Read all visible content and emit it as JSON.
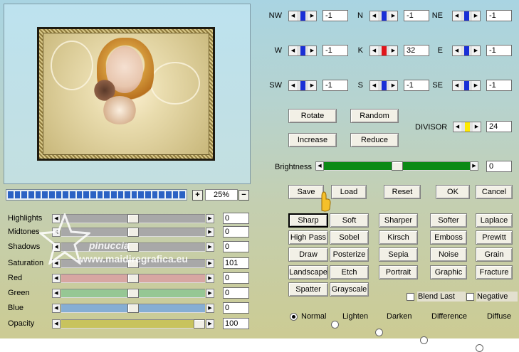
{
  "directions": [
    {
      "label": "NW",
      "value": "-1",
      "color": "#1a2fd6"
    },
    {
      "label": "N",
      "value": "-1",
      "color": "#1a2fd6"
    },
    {
      "label": "NE",
      "value": "-1",
      "color": "#1a2fd6"
    },
    {
      "label": "W",
      "value": "-1",
      "color": "#1a2fd6"
    },
    {
      "label": "K",
      "value": "32",
      "color": "#e0151b"
    },
    {
      "label": "E",
      "value": "-1",
      "color": "#1a2fd6"
    },
    {
      "label": "SW",
      "value": "-1",
      "color": "#1a2fd6"
    },
    {
      "label": "S",
      "value": "-1",
      "color": "#1a2fd6"
    },
    {
      "label": "SE",
      "value": "-1",
      "color": "#1a2fd6"
    }
  ],
  "actions": {
    "rotate": "Rotate",
    "random": "Random",
    "increase": "Increase",
    "reduce": "Reduce"
  },
  "divisor": {
    "label": "DIVISOR",
    "value": "24",
    "color": "#ffea00"
  },
  "brightness": {
    "label": "Brightness",
    "value": "0",
    "level": 0.5
  },
  "file_buttons": {
    "save": "Save",
    "load": "Load",
    "reset": "Reset",
    "ok": "OK",
    "cancel": "Cancel"
  },
  "zoom": {
    "plus": "+",
    "minus": "−",
    "value": "25%",
    "progress": 1.0
  },
  "presets": [
    [
      "Sharp",
      "Soft",
      "Sharper",
      "Softer",
      "Laplace"
    ],
    [
      "High Pass",
      "Sobel",
      "Kirsch",
      "Emboss",
      "Prewitt"
    ],
    [
      "Draw",
      "Posterize",
      "Sepia",
      "Noise",
      "Grain"
    ],
    [
      "Landscape",
      "Etch",
      "Portrait",
      "Graphic",
      "Fracture"
    ],
    [
      "Spatter",
      "Grayscale"
    ]
  ],
  "selected_preset": "Sharp",
  "options": {
    "blend_last": "Blend Last",
    "negative": "Negative"
  },
  "modes": [
    "Normal",
    "Lighten",
    "Darken",
    "Difference",
    "Diffuse"
  ],
  "selected_mode": "Normal",
  "sliders": [
    {
      "label": "Highlights",
      "value": "0",
      "level": 0.5,
      "color": "#a8a8a8"
    },
    {
      "label": "Midtones",
      "value": "0",
      "level": 0.5,
      "color": "#a8a8a8"
    },
    {
      "label": "Shadows",
      "value": "0",
      "level": 0.5,
      "color": "#a8a8a8"
    },
    {
      "label": "Saturation",
      "value": "101",
      "level": 0.5,
      "color": "#a8a8a8"
    },
    {
      "label": "Red",
      "value": "0",
      "level": 0.5,
      "color": "#d7a6a2"
    },
    {
      "label": "Green",
      "value": "0",
      "level": 0.5,
      "color": "#96c794"
    },
    {
      "label": "Blue",
      "value": "0",
      "level": 0.5,
      "color": "#86aed4"
    },
    {
      "label": "Opacity",
      "value": "100",
      "level": 1.0,
      "color": "#c8c35d"
    }
  ],
  "watermark": {
    "name": "pinuccia",
    "site": "www.maidiregrafica.eu"
  }
}
